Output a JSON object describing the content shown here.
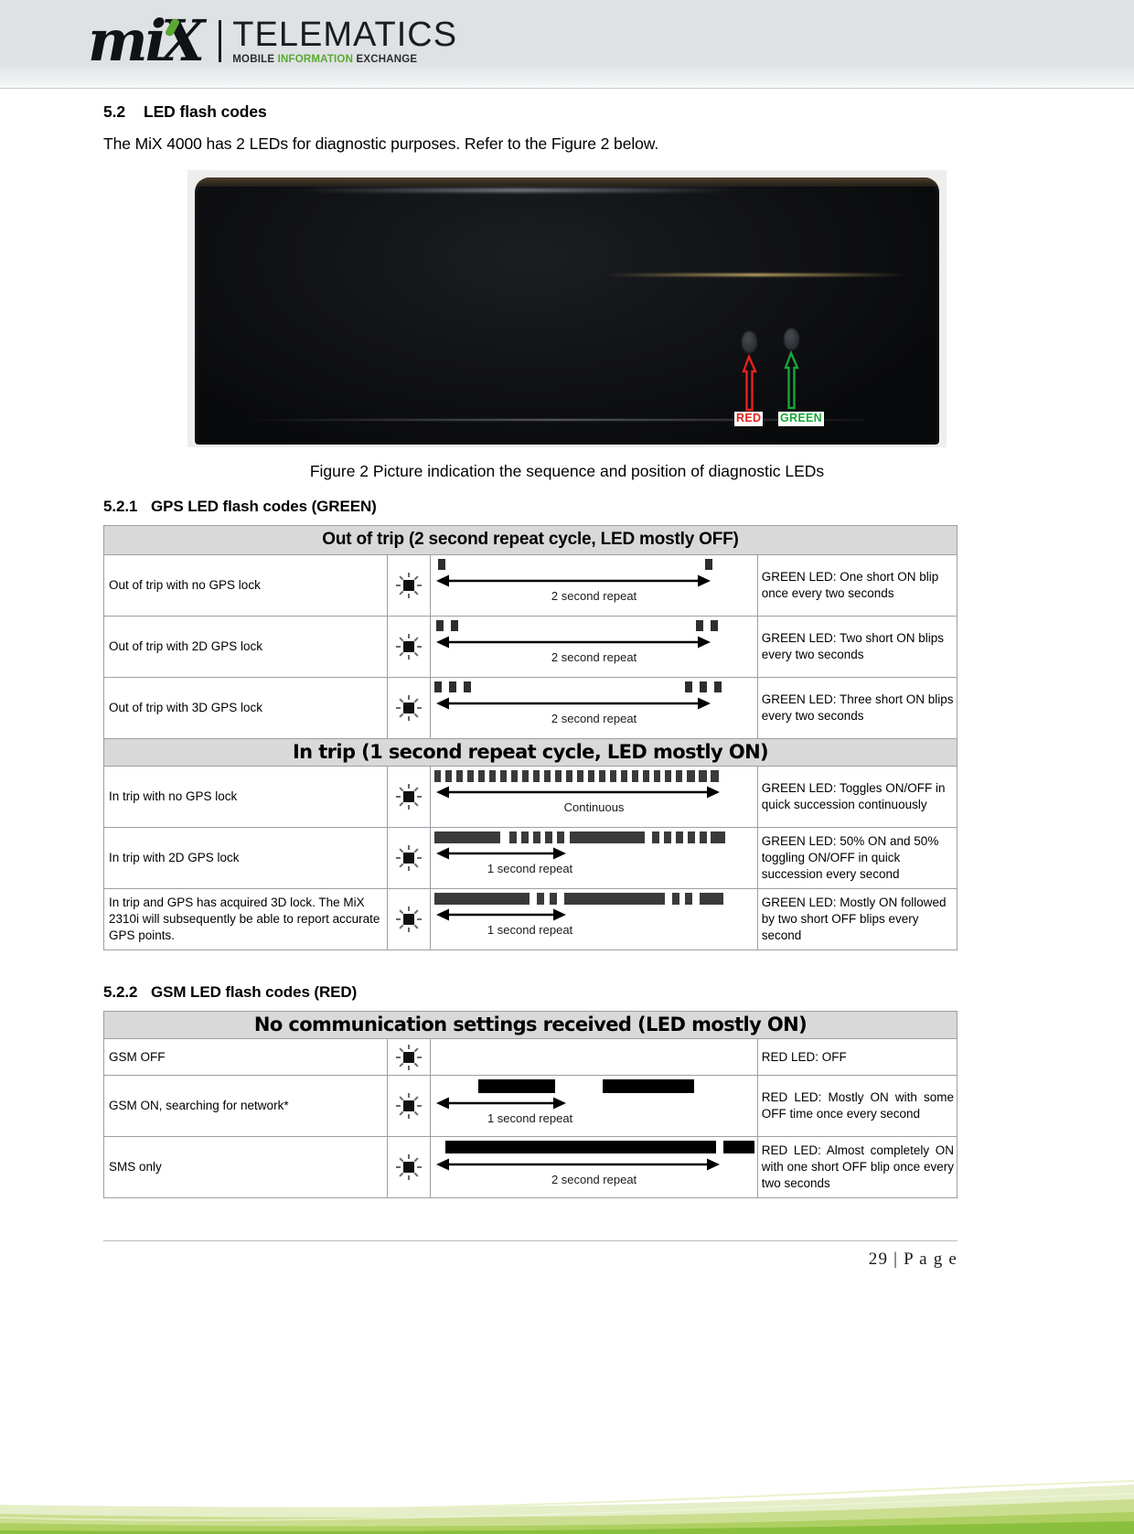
{
  "header": {
    "logo_mark": "m'X",
    "logo_title": "TELEMATICS",
    "logo_sub_1": "MOBILE ",
    "logo_sub_2": "INFORMATION ",
    "logo_sub_3": "EXCHANGE",
    "accent_green": "#5aa832"
  },
  "section": {
    "h2_number": "5.2",
    "h2_title": "LED flash codes",
    "intro": "The MiX 4000 has 2 LEDs for diagnostic purposes.  Refer to the Figure 2 below.",
    "figure_caption": "Figure 2 Picture indication the sequence and position of diagnostic LEDs",
    "led_label_red": "RED",
    "led_label_green": "GREEN",
    "color_red": "#e8211b",
    "color_green": "#18a638"
  },
  "gps_section": {
    "number": "5.2.1",
    "title": "GPS LED flash codes (GREEN)",
    "group_1_header": "Out of trip (2 second repeat cycle, LED mostly OFF)",
    "group_2_header": "In trip (1 second repeat cycle, LED mostly ON)",
    "rows": [
      {
        "description": "Out of trip with no GPS lock",
        "timing_label": "2 second repeat",
        "note": "GREEN LED: One short ON blip once every two seconds"
      },
      {
        "description": "Out of trip with 2D GPS lock",
        "timing_label": "2 second repeat",
        "note": "GREEN LED: Two short ON blips every two seconds"
      },
      {
        "description": "Out of trip with 3D GPS lock",
        "timing_label": "2 second repeat",
        "note": "GREEN LED: Three short ON blips every two seconds"
      },
      {
        "description": "In trip with no GPS lock",
        "timing_label": "Continuous",
        "note": "GREEN LED: Toggles ON/OFF in quick succession continuously"
      },
      {
        "description": "In trip with 2D GPS lock",
        "timing_label": "1 second repeat",
        "note": "GREEN LED: 50% ON and 50% toggling ON/OFF in quick succession every second"
      },
      {
        "description": "In trip and GPS has acquired 3D lock. The MiX 2310i will subsequently be able to report accurate GPS points.",
        "timing_label": "1 second repeat",
        "note": "GREEN LED: Mostly ON followed by two short OFF blips every second"
      }
    ]
  },
  "gsm_section": {
    "number": "5.2.2",
    "title": "GSM LED flash codes (RED)",
    "group_header": "No communication settings received (LED mostly ON)",
    "rows": [
      {
        "description": "GSM OFF",
        "timing_label": "",
        "note": "RED LED: OFF"
      },
      {
        "description": "GSM ON, searching for network*",
        "timing_label": "1 second repeat",
        "note": "RED LED: Mostly ON with some OFF time once every second"
      },
      {
        "description": "SMS only",
        "timing_label": "2 second repeat",
        "note": "RED LED:  Almost  completely ON with one short OFF blip once every two seconds"
      }
    ]
  },
  "footer": {
    "page_number": "29",
    "page_label": "| P a g e"
  }
}
